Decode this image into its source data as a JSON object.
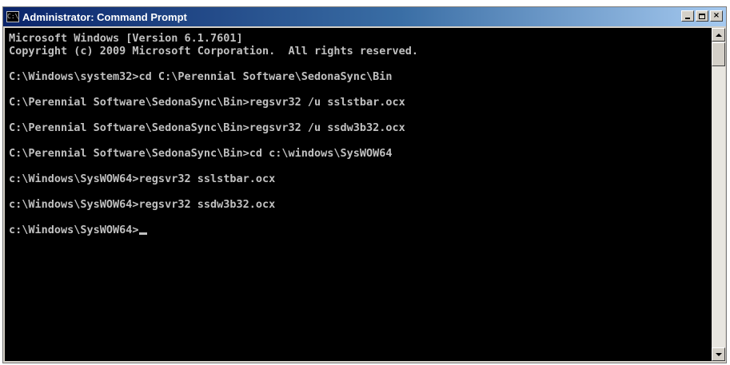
{
  "window": {
    "title": "Administrator: Command Prompt",
    "icon": "console-icon",
    "controls": {
      "minimize": "minimize-icon",
      "maximize": "maximize-icon",
      "close": "×"
    }
  },
  "console": {
    "lines": [
      "Microsoft Windows [Version 6.1.7601]",
      "Copyright (c) 2009 Microsoft Corporation.  All rights reserved.",
      "",
      "C:\\Windows\\system32>cd C:\\Perennial Software\\SedonaSync\\Bin",
      "",
      "C:\\Perennial Software\\SedonaSync\\Bin>regsvr32 /u sslstbar.ocx",
      "",
      "C:\\Perennial Software\\SedonaSync\\Bin>regsvr32 /u ssdw3b32.ocx",
      "",
      "C:\\Perennial Software\\SedonaSync\\Bin>cd c:\\windows\\SysWOW64",
      "",
      "c:\\Windows\\SysWOW64>regsvr32 sslstbar.ocx",
      "",
      "c:\\Windows\\SysWOW64>regsvr32 ssdw3b32.ocx",
      "",
      "c:\\Windows\\SysWOW64>"
    ],
    "text_color": "#c0c0c0",
    "background_color": "#000000"
  },
  "scrollbar": {
    "up_icon": "scroll-up-arrow-icon",
    "down_icon": "scroll-down-arrow-icon"
  }
}
